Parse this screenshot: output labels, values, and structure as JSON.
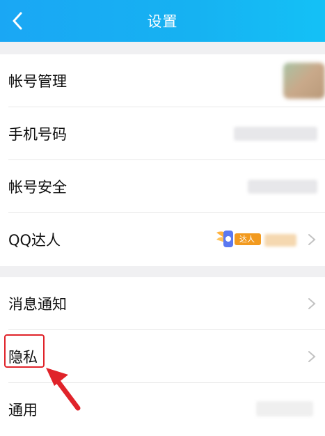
{
  "header": {
    "title": "设置"
  },
  "group1": {
    "items": [
      {
        "label": "帐号管理"
      },
      {
        "label": "手机号码"
      },
      {
        "label": "帐号安全"
      },
      {
        "label": "QQ达人",
        "badge": "达人"
      }
    ]
  },
  "group2": {
    "items": [
      {
        "label": "消息通知"
      },
      {
        "label": "隐私"
      },
      {
        "label": "通用"
      }
    ]
  },
  "colors": {
    "header": "#1aa7f4",
    "highlight": "#e0232a"
  },
  "icons": [
    "back-icon",
    "chevron-right-icon",
    "arrow-pointer-icon"
  ]
}
